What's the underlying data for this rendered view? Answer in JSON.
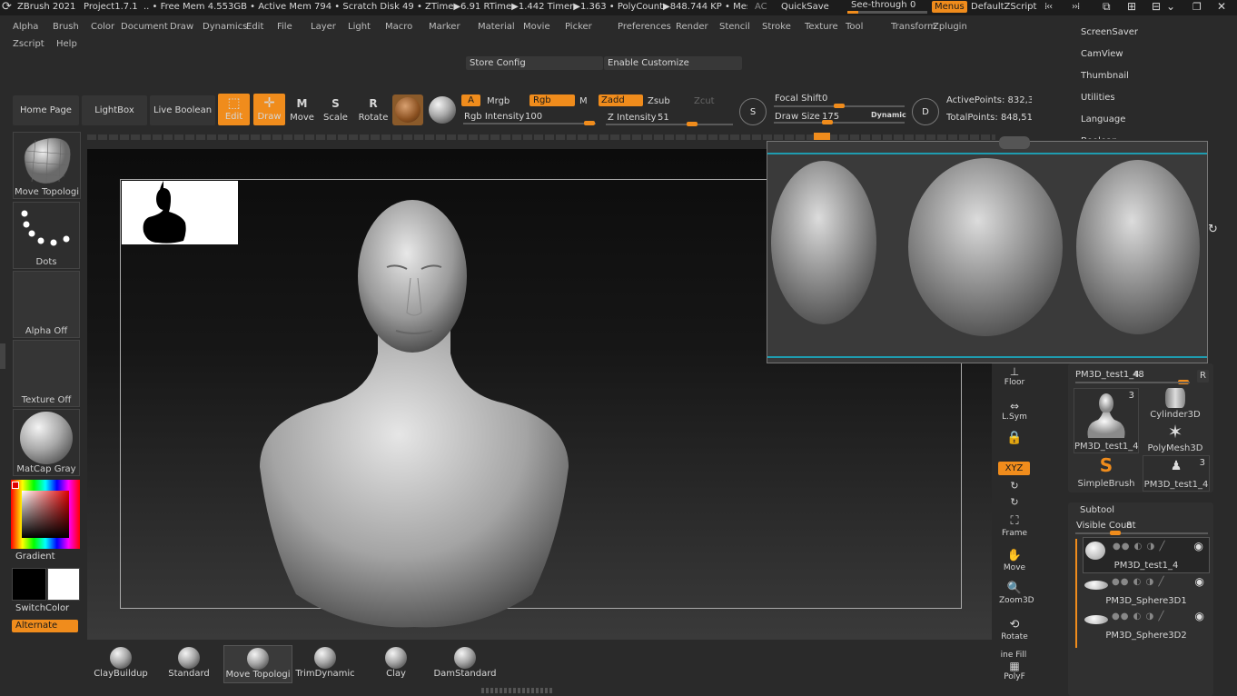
{
  "titlebar": {
    "app": "ZBrush 2021",
    "project": "Project1.7.1",
    "status": ".. • Free Mem 4.553GB • Active Mem 794 • Scratch Disk 49 • ZTime▶6.91 RTime▶1.442 Timer▶1.363 • PolyCount▶848.744 KP • Mesh",
    "ac": "AC",
    "quicksave": "QuickSave",
    "see_through": "See-through",
    "see_through_value": "0",
    "menus": "Menus",
    "script": "DefaultZScript"
  },
  "menus": [
    "Alpha",
    "Brush",
    "Color",
    "Document",
    "Draw",
    "Dynamics",
    "Edit",
    "File",
    "Layer",
    "Light",
    "Macro",
    "Marker",
    "Material",
    "Movie",
    "Picker",
    "Preferences",
    "Render",
    "Stencil",
    "Stroke",
    "Texture",
    "Tool",
    "Transform",
    "Zplugin"
  ],
  "menus_row2": [
    "Zscript",
    "Help"
  ],
  "config": {
    "store": "Store Config",
    "customize": "Enable Customize"
  },
  "shelf": {
    "home": "Home Page",
    "lightbox": "LightBox",
    "liveboolean": "Live Boolean",
    "edit": "Edit",
    "draw": "Draw",
    "move": "Move",
    "scale": "Scale",
    "rotate": "Rotate",
    "a": "A",
    "mrgb": "Mrgb",
    "rgb": "Rgb",
    "m": "M",
    "zadd": "Zadd",
    "zsub": "Zsub",
    "zcut": "Zcut",
    "rgb_intensity_label": "Rgb Intensity",
    "rgb_intensity": "100",
    "z_intensity_label": "Z Intensity",
    "z_intensity": "51",
    "focal_shift_label": "Focal Shift",
    "focal_shift": "0",
    "draw_size_label": "Draw Size",
    "draw_size": "175",
    "dynamic": "Dynamic",
    "active_points": "ActivePoints: 832,3",
    "total_points": "TotalPoints: 848,51",
    "s": "S",
    "d": "D"
  },
  "left": {
    "brush": "Move Topologi",
    "stroke": "Dots",
    "alpha": "Alpha Off",
    "texture": "Texture Off",
    "material": "MatCap Gray",
    "gradient": "Gradient",
    "switchcolor": "SwitchColor",
    "alternate": "Alternate"
  },
  "bottom_brushes": [
    "ClayBuildup",
    "Standard",
    "Move Topologi",
    "TrimDynamic",
    "Clay",
    "DamStandard"
  ],
  "right_nav": [
    "ScreenSaver",
    "CamView",
    "Thumbnail",
    "Utilities",
    "Language",
    "Boolean"
  ],
  "right_tools": {
    "floor": "Floor",
    "lsym": "L.Sym",
    "xyz": "XYZ",
    "frame": "Frame",
    "move": "Move",
    "zoom3d": "Zoom3D",
    "rotate": "Rotate",
    "line_fill": "ine Fill",
    "polyf": "PolyF"
  },
  "tool_panel": {
    "current": "PM3D_test1_4.",
    "current_value": "48",
    "r": "R",
    "items": [
      {
        "name": "PM3D_test1_4",
        "count": "3"
      },
      {
        "name": "Cylinder3D"
      },
      {
        "name": "PolyMesh3D"
      },
      {
        "name": "SimpleBrush"
      },
      {
        "name": "PM3D_test1_4",
        "count": "3"
      }
    ]
  },
  "subtool": {
    "title": "Subtool",
    "visible_count_label": "Visible Count",
    "visible_count": "8",
    "items": [
      "PM3D_test1_4",
      "PM3D_Sphere3D1",
      "PM3D_Sphere3D2"
    ]
  },
  "colors": {
    "accent": "#f08c1c",
    "bg": "#2a2a2a",
    "teal": "#1e9cb0"
  }
}
